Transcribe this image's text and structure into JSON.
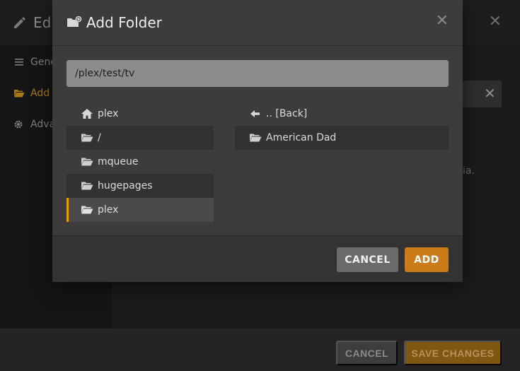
{
  "background": {
    "title": "Edi",
    "sidebar": [
      {
        "label": "Gene",
        "icon": "list-icon",
        "active": false
      },
      {
        "label": "Add",
        "icon": "folder-open-icon",
        "active": true
      },
      {
        "label": "Adva",
        "icon": "gear-icon",
        "active": false
      }
    ],
    "hint_text": "ia.",
    "footer": {
      "cancel_label": "CANCEL",
      "save_label": "SAVE CHANGES"
    }
  },
  "modal": {
    "title": "Add Folder",
    "path_value": "/plex/test/tv",
    "left_list": [
      {
        "label": "plex",
        "icon": "home-icon",
        "selected": false
      },
      {
        "label": "/",
        "icon": "folder-open-icon",
        "selected": false
      },
      {
        "label": "mqueue",
        "icon": "folder-open-icon",
        "selected": false
      },
      {
        "label": "hugepages",
        "icon": "folder-open-icon",
        "selected": false
      },
      {
        "label": "plex",
        "icon": "folder-open-icon",
        "selected": true
      }
    ],
    "right_list": [
      {
        "label": ".. [Back]",
        "icon": "arrow-left-icon"
      },
      {
        "label": "American Dad",
        "icon": "folder-open-icon"
      }
    ],
    "cancel_label": "CANCEL",
    "add_label": "ADD"
  },
  "colors": {
    "accent": "#e5a00d",
    "add_button": "#cc7b19",
    "modal_bg": "#3c3c3c"
  }
}
